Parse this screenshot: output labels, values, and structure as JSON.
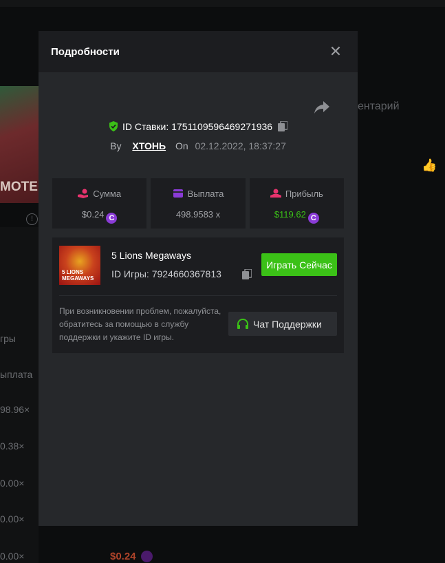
{
  "background": {
    "game_banner_text": "MOTEL",
    "right_partial_text": "ентарий",
    "side_labels": [
      "гры",
      "ыплата",
      "98.96×",
      "0.38×",
      "0.00×",
      "0.00×",
      "0.00×"
    ],
    "bottom_amount": "$0.24"
  },
  "modal": {
    "title": "Подробности",
    "close_icon": "close-icon",
    "share_icon": "share-icon",
    "bet_id_label": "ID Ставки:",
    "bet_id_value": "1751109596469271936",
    "by_label": "By",
    "username": "XTOHЬ",
    "on_label": "On",
    "date": "02.12.2022, 18:37:27"
  },
  "stats": [
    {
      "label": "Сумма",
      "value": "$0.24",
      "icon": "coins-hand-icon",
      "color": "#e8336d"
    },
    {
      "label": "Выплата",
      "value": "498.9583 x",
      "icon": "wallet-icon",
      "color": "#8a3bd6"
    },
    {
      "label": "Прибыль",
      "value": "$119.62",
      "icon": "profit-hand-icon",
      "color": "#e8336d"
    }
  ],
  "game": {
    "name": "5 Lions Megaways",
    "id_label": "ID Игры:",
    "id_value": "7924660367813",
    "thumb_text": "5 LIONS MEGAWAYS",
    "play_button": "Играть Сейчас",
    "help_text": "При возникновении проблем, пожалуйста, обратитесь за помощью в службу поддержки и укажите ID игры.",
    "support_button": "Чат Поддержки"
  },
  "colors": {
    "accent_green": "#3bc117",
    "coin_purple": "#8a3bd6",
    "modal_bg": "#26282b",
    "panel_bg": "#1c1d20"
  }
}
